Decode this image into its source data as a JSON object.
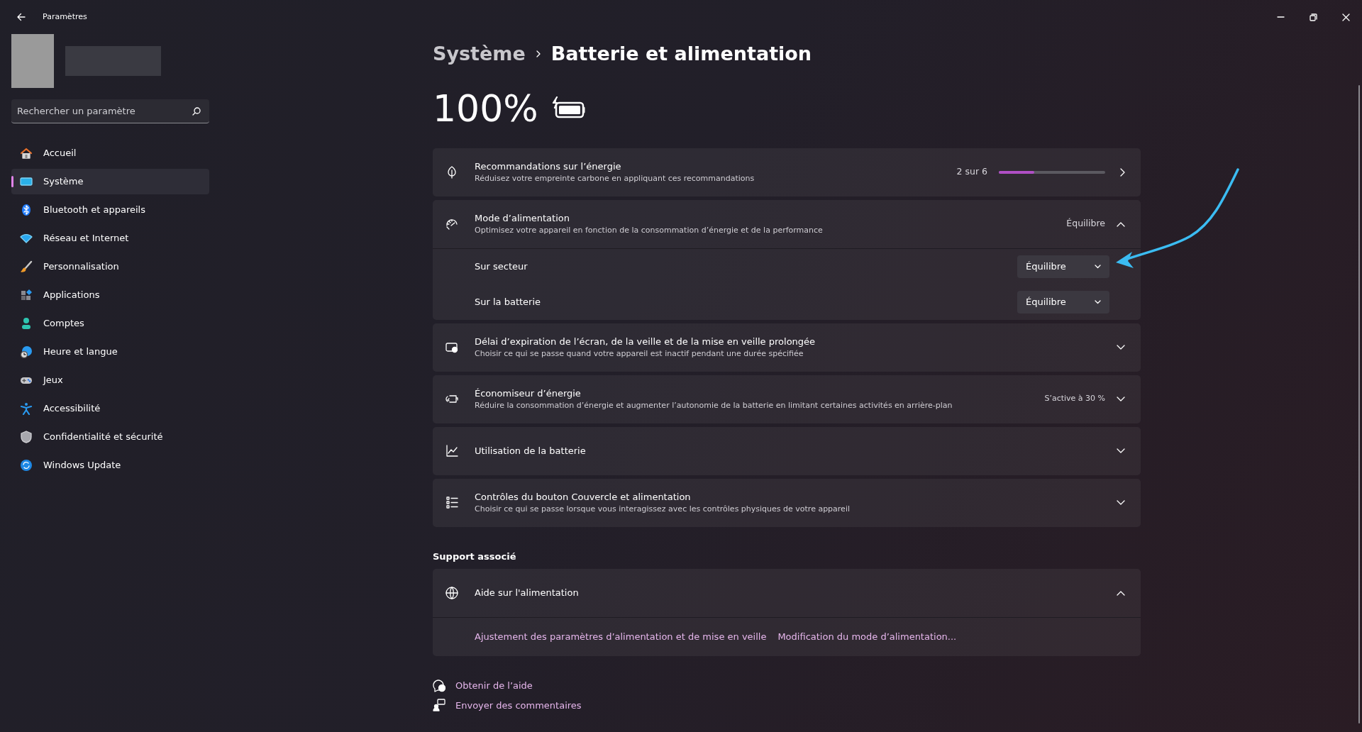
{
  "window": {
    "title": "Paramètres"
  },
  "sidebar": {
    "search": {
      "placeholder": "Rechercher un paramètre"
    },
    "items": [
      {
        "label": "Accueil",
        "selected": false
      },
      {
        "label": "Système",
        "selected": true
      },
      {
        "label": "Bluetooth et appareils",
        "selected": false
      },
      {
        "label": "Réseau et Internet",
        "selected": false
      },
      {
        "label": "Personnalisation",
        "selected": false
      },
      {
        "label": "Applications",
        "selected": false
      },
      {
        "label": "Comptes",
        "selected": false
      },
      {
        "label": "Heure et langue",
        "selected": false
      },
      {
        "label": "Jeux",
        "selected": false
      },
      {
        "label": "Accessibilité",
        "selected": false
      },
      {
        "label": "Confidentialité et sécurité",
        "selected": false
      },
      {
        "label": "Windows Update",
        "selected": false
      }
    ]
  },
  "breadcrumb": {
    "parent": "Système",
    "current": "Batterie et alimentation"
  },
  "battery": {
    "percent": "100%"
  },
  "cards": [
    {
      "kind": "progress",
      "title": "Recommandations sur l’énergie",
      "description": "Réduisez votre empreinte carbone en appliquant ces recommandations",
      "status": "2 sur 6",
      "level": 0.333
    },
    {
      "kind": "expander",
      "title": "Mode d’alimentation",
      "description": "Optimisez votre appareil en fonction de la consommation d’énergie et de la performance",
      "status": "Équilibre",
      "expanded": true,
      "rows": [
        {
          "label": "Sur secteur",
          "value": "Équilibre"
        },
        {
          "label": "Sur la batterie",
          "value": "Équilibre"
        }
      ]
    },
    {
      "kind": "expander",
      "title": "Délai d’expiration de l’écran, de la veille et de la mise en veille prolongée",
      "description": "Choisir ce qui se passe quand votre appareil est inactif pendant une durée spécifiée",
      "expanded": false
    },
    {
      "kind": "expander",
      "title": "Économiseur d’énergie",
      "description": "Réduire la consommation d’énergie et augmenter l’autonomie de la batterie en limitant certaines activités en arrière-plan",
      "status": "S’active à 30 %",
      "expanded": false
    },
    {
      "kind": "expander",
      "title": "Utilisation de la batterie",
      "expanded": false
    },
    {
      "kind": "expander",
      "title": "Contrôles du bouton Couvercle et alimentation",
      "description": "Choisir ce qui se passe lorsque vous interagissez avec les contrôles physiques de votre appareil",
      "expanded": false
    }
  ],
  "support": {
    "heading": "Support associé",
    "card": {
      "title": "Aide sur l'alimentation",
      "expanded": true,
      "links": [
        "Ajustement des paramètres d’alimentation et de mise en veille",
        "Modification du mode d’alimentation..."
      ]
    }
  },
  "footer_links": [
    "Obtenir de l’aide",
    "Envoyer des commentaires"
  ]
}
